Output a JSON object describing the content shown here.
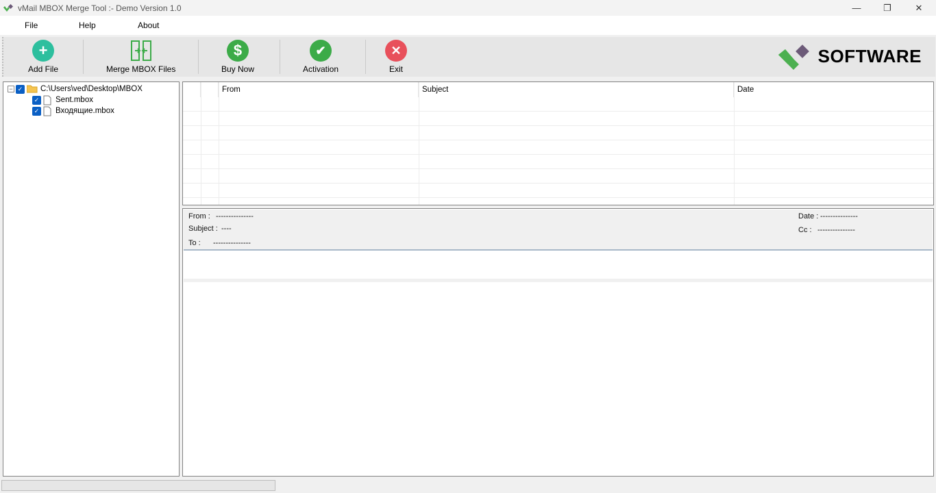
{
  "window": {
    "title": "vMail MBOX Merge Tool  :- Demo Version 1.0",
    "minimize": "—",
    "restore": "❐",
    "close": "✕"
  },
  "menu": [
    "File",
    "Help",
    "About"
  ],
  "toolbar": {
    "add_file": "Add File",
    "merge": "Merge MBOX Files",
    "buy_now": "Buy Now",
    "activation": "Activation",
    "exit": "Exit"
  },
  "logo": {
    "text": "SOFTWARE",
    "colors": {
      "green": "#4cb050",
      "purple": "#6c5a78"
    }
  },
  "tree": {
    "root": "C:\\Users\\ved\\Desktop\\MBOX",
    "children": [
      "Sent.mbox",
      "Входящие.mbox"
    ]
  },
  "grid": {
    "columns": [
      "From",
      "Subject",
      "Date"
    ]
  },
  "preview": {
    "from_label": "From :",
    "from_value": "---------------",
    "subject_label": "Subject :",
    "subject_value": "----",
    "to_label": "To :",
    "to_value": "---------------",
    "date_label": "Date :",
    "date_value": "---------------",
    "cc_label": "Cc :",
    "cc_value": "---------------"
  },
  "colors": {
    "add": "#2dbf9e",
    "merge": "#3cab48",
    "buy": "#3cab48",
    "activation": "#3cab48",
    "exit": "#e8505b"
  }
}
